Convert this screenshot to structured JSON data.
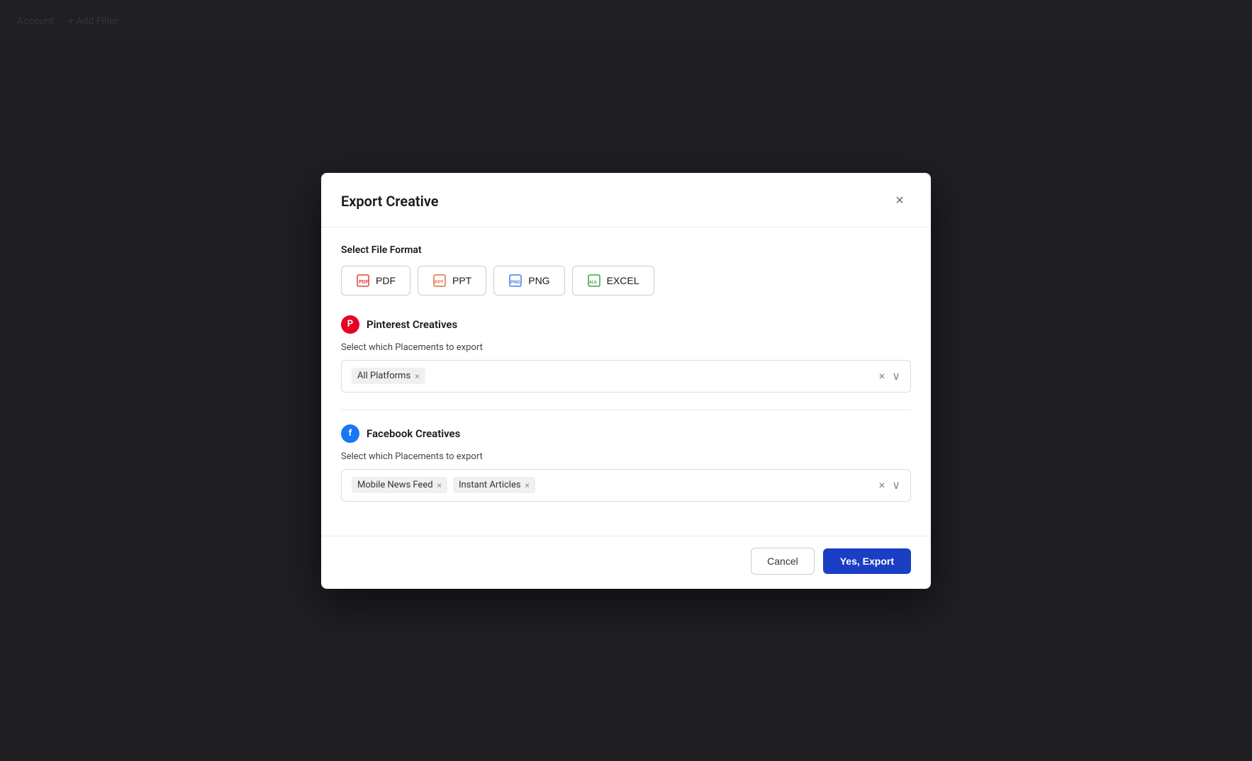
{
  "background": {
    "account_label": "Account",
    "add_filter_label": "+ Add Filter"
  },
  "modal": {
    "title": "Export Creative",
    "close_label": "×",
    "file_format_section_label": "Select File Format",
    "formats": [
      {
        "id": "pdf",
        "label": "PDF",
        "icon": "pdf-icon"
      },
      {
        "id": "ppt",
        "label": "PPT",
        "icon": "ppt-icon"
      },
      {
        "id": "png",
        "label": "PNG",
        "icon": "png-icon"
      },
      {
        "id": "excel",
        "label": "EXCEL",
        "icon": "excel-icon"
      }
    ],
    "pinterest_section": {
      "title": "Pinterest Creatives",
      "placement_label": "Select which Placements to export",
      "selected_tags": [
        {
          "id": "all_platforms",
          "label": "All Platforms"
        }
      ]
    },
    "facebook_section": {
      "title": "Facebook Creatives",
      "placement_label": "Select which Placements to export",
      "selected_tags": [
        {
          "id": "mobile_news_feed",
          "label": "Mobile News Feed"
        },
        {
          "id": "instant_articles",
          "label": "Instant Articles"
        }
      ]
    },
    "cancel_label": "Cancel",
    "export_label": "Yes, Export"
  }
}
